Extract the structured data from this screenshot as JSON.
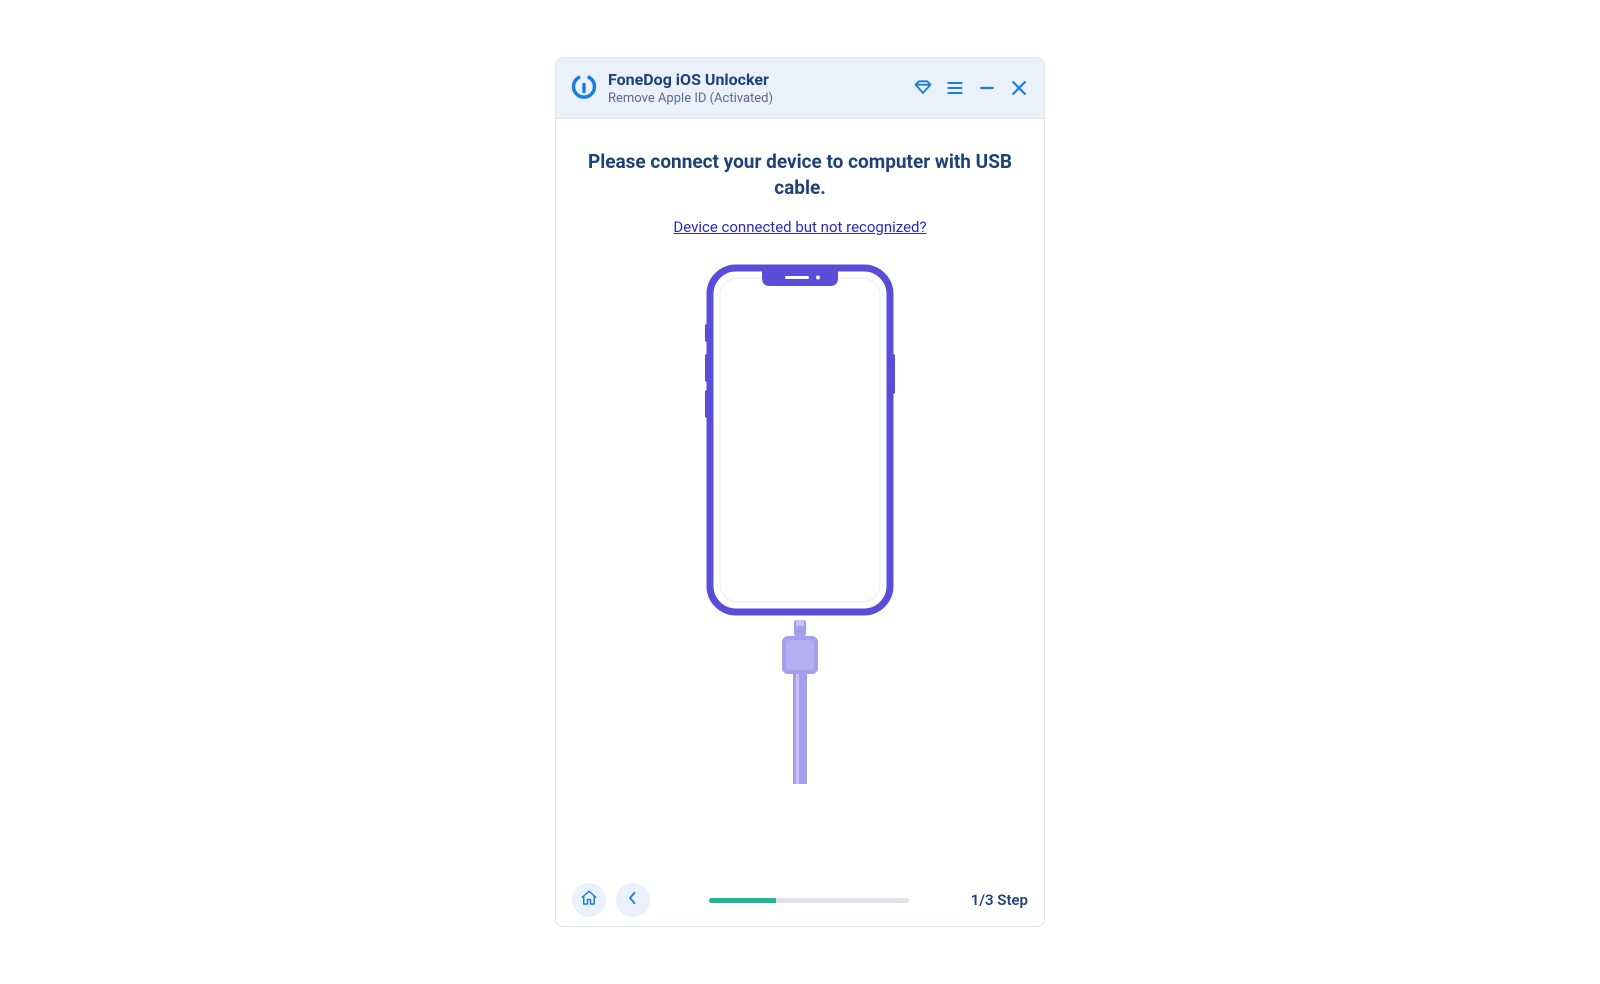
{
  "header": {
    "app_title": "FoneDog iOS Unlocker",
    "subtitle": "Remove Apple ID  (Activated)"
  },
  "content": {
    "instruction": "Please connect your device to computer with USB cable.",
    "help_link": "Device connected but not recognized?"
  },
  "footer": {
    "step_label": "1/3 Step",
    "progress_percent": 33.3
  },
  "colors": {
    "primary_text": "#1d4178",
    "link": "#2b27c9",
    "accent_blue": "#1d7ed8",
    "phone_frame": "#5a4dd8",
    "cable": "#a59eec",
    "progress": "#1ab894"
  }
}
